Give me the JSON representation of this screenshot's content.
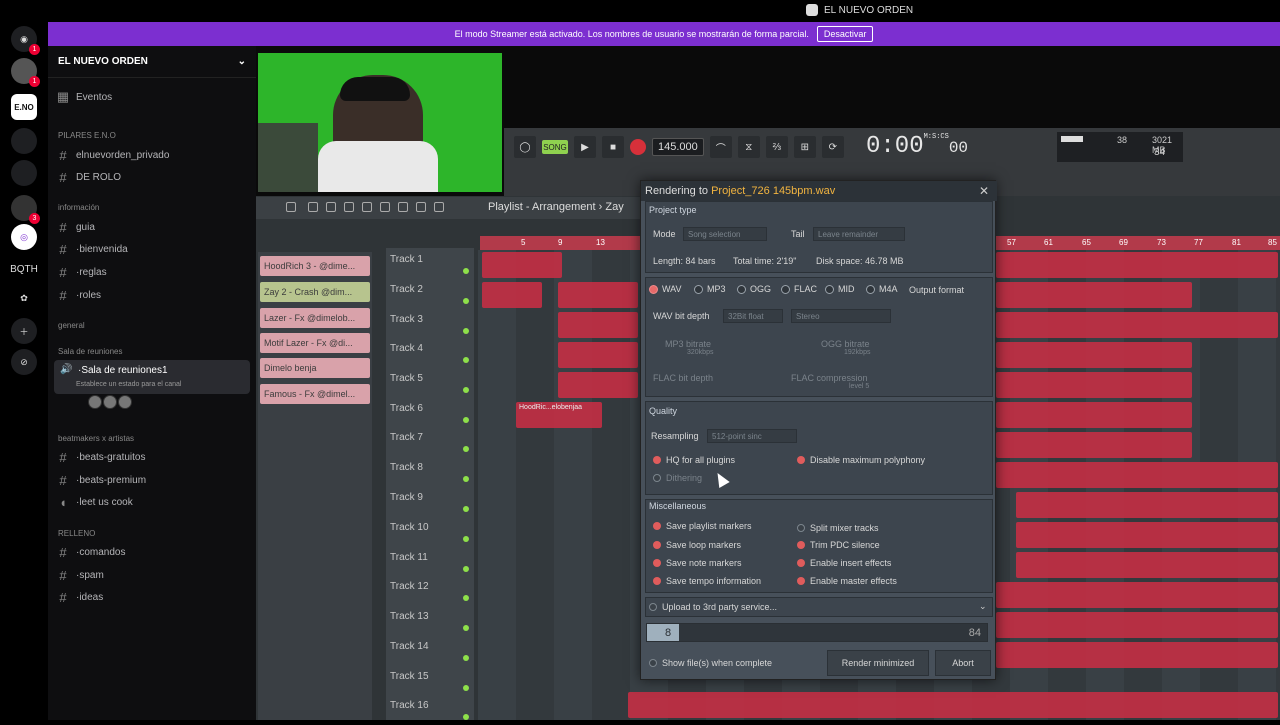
{
  "window": {
    "title": "EL NUEVO ORDEN"
  },
  "banner": {
    "text": "El modo Streamer está activado. Los nombres de usuario se mostrarán de forma parcial.",
    "button": "Desactivar"
  },
  "servers": [
    {
      "name": "discord-icon",
      "badge": "1"
    },
    {
      "name": "user-avatar",
      "badge": "1"
    },
    {
      "name": "eno-server",
      "label": "E.NO",
      "badge": ""
    },
    {
      "name": "gaming-server",
      "label": "",
      "badge": ""
    },
    {
      "name": "idols-server",
      "label": "",
      "badge": ""
    },
    {
      "name": "server-6",
      "label": "",
      "badge": "3"
    },
    {
      "name": "server-7",
      "label": "",
      "badge": ""
    },
    {
      "name": "bqth-server",
      "label": "BQTH",
      "badge": ""
    }
  ],
  "sidebar": {
    "server_name": "EL NUEVO ORDEN",
    "events": "Eventos",
    "cat_pilares": "PILARES E.N.O",
    "ch_privado": "elnuevorden_privado",
    "ch_derolo": "DE ROLO",
    "cat_info": "información",
    "ch_guia": "guia",
    "ch_bienvenida": "·bienvenida",
    "ch_reglas": "·reglas",
    "ch_roles": "·roles",
    "cat_general": "general",
    "cat_sala": "Sala de reuniones",
    "voice_name": "·Sala de reuniones1",
    "voice_status": "Establece un estado para el canal",
    "cat_beat": "beatmakers x artistas",
    "ch_beats_gratis": "·beats-gratuitos",
    "ch_beats_premium": "·beats-premium",
    "ch_cook": "·leet us cook",
    "cat_relleno": "RELLENO",
    "ch_comandos": "·comandos",
    "ch_spam": "·spam",
    "ch_ideas": "·ideas"
  },
  "fl": {
    "song_btn": "SONG",
    "tempo": "145.000",
    "time": "0:00",
    "time_small": "00",
    "time_label": "M:S:CS",
    "cpu_a": "38",
    "cpu_b": "3021 MB",
    "cpu_c": "34",
    "playlist_title": "Playlist - Arrangement",
    "playlist_title_rest": "Zay",
    "patterns": [
      "HoodRich 3 - @dime...",
      "Zay 2 - Crash @dim...",
      "Lazer - Fx @dimelob...",
      "Motif Lazer - Fx @di...",
      "Dimelo benja",
      "Famous - Fx @dimel..."
    ],
    "tracks": [
      "Track 1",
      "Track 2",
      "Track 3",
      "Track 4",
      "Track 5",
      "Track 6",
      "Track 7",
      "Track 8",
      "Track 9",
      "Track 10",
      "Track 11",
      "Track 12",
      "Track 13",
      "Track 14",
      "Track 15",
      "Track 16"
    ],
    "ruler": [
      "5",
      "9",
      "13",
      "57",
      "61",
      "65",
      "69",
      "73",
      "77",
      "81",
      "85"
    ],
    "clip_label": "HoodRic...elobenjaa"
  },
  "dialog": {
    "title_prefix": "Rendering to",
    "title_file": "Project_726 145bpm.wav",
    "project_type": "Project type",
    "mode_label": "Mode",
    "mode_value": "Song selection",
    "tail_label": "Tail",
    "tail_value": "Leave remainder",
    "length": "Length: 84 bars",
    "total_time": "Total time: 2'19\"",
    "disk_space": "Disk space: 46.78 MB",
    "formats": [
      "WAV",
      "MP3",
      "OGG",
      "FLAC",
      "MID",
      "M4A"
    ],
    "output_format": "Output format",
    "wav_bit_depth": "WAV bit depth",
    "bit_value": "32Bit float",
    "stereo": "Stereo",
    "mp3_bitrate": "MP3 bitrate",
    "mp3_val": "320kbps",
    "ogg_bitrate": "OGG bitrate",
    "ogg_val": "192kbps",
    "flac_bit_depth": "FLAC bit depth",
    "flac_compression": "FLAC compression",
    "flac_level": "level 5",
    "quality": "Quality",
    "resampling": "Resampling",
    "resampling_value": "512-point sinc",
    "hq_plugins": "HQ for all plugins",
    "disable_poly": "Disable maximum polyphony",
    "dithering": "Dithering",
    "misc": "Miscellaneous",
    "misc_left": [
      "Save playlist markers",
      "Save loop markers",
      "Save note markers",
      "Save tempo information"
    ],
    "misc_right": [
      "Split mixer tracks",
      "Trim PDC silence",
      "Enable insert effects",
      "Enable master effects"
    ],
    "upload": "Upload to 3rd party service...",
    "progress": {
      "current": "8",
      "total": "84",
      "fraction": 0.095
    },
    "show_files": "Show file(s) when complete",
    "render_min": "Render minimized",
    "abort": "Abort"
  }
}
